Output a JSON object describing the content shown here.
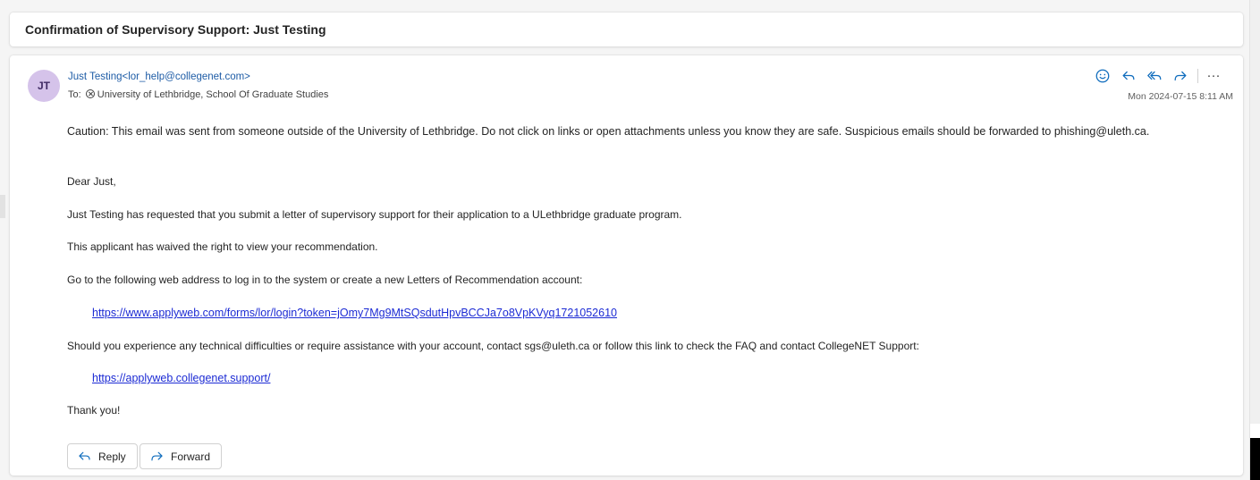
{
  "email": {
    "subject": "Confirmation of Supervisory Support: Just Testing",
    "avatar_initials": "JT",
    "sender": "Just Testing<lor_help@collegenet.com>",
    "to_label": "To:",
    "recipient": "University of Lethbridge, School Of Graduate Studies",
    "date": "Mon 2024-07-15 8:11 AM",
    "caution": "Caution: This email was sent from someone outside of the University of Lethbridge. Do not click on links or open attachments unless you know they are safe. Suspicious emails should be forwarded to phishing@uleth.ca.",
    "greeting": "Dear Just,",
    "para1": "Just Testing has requested that you submit a letter of supervisory support for their application to a ULethbridge graduate program.",
    "para2": "This applicant has waived the right to view your recommendation.",
    "para3": "Go to the following web address to log in to the system or create a new Letters of Recommendation account:",
    "link1": "https://www.applyweb.com/forms/lor/login?token=jOmy7Mg9MtSQsdutHpvBCCJa7o8VpKVyq1721052610",
    "para4": "Should you experience any technical difficulties or require assistance with your account, contact sgs@uleth.ca or follow this link to check the FAQ and contact CollegeNET Support:",
    "link2": "https://applyweb.collegenet.support/",
    "closing": "Thank you!"
  },
  "actions": {
    "more_label": "···",
    "reply_label": "Reply",
    "forward_label": "Forward"
  },
  "icons": {
    "emoji": "smiley-icon",
    "reply": "reply-arrow-icon",
    "reply_all": "reply-all-arrow-icon",
    "forward": "forward-arrow-icon",
    "remove_recipient": "x-circle-icon"
  },
  "colors": {
    "accent": "#1e5ca6",
    "link": "#1c2bd4",
    "avatar_bg": "#d5c3ea",
    "action_icon": "#0f6cbd"
  }
}
